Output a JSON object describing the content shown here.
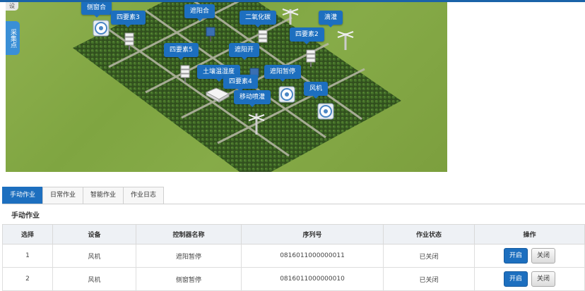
{
  "farm_view": {
    "side_tab_top": "设",
    "side_tab_label": "采集点",
    "device_tags": [
      {
        "label": "侧窗合"
      },
      {
        "label": "四要素3"
      },
      {
        "label": "遮阳合"
      },
      {
        "label": "二氧化碳"
      },
      {
        "label": "滴灌"
      },
      {
        "label": "四要素2"
      },
      {
        "label": "四要素5"
      },
      {
        "label": "遮阳开"
      },
      {
        "label": "土壤温湿度"
      },
      {
        "label": "遮阳暂停"
      },
      {
        "label": "四要素4"
      },
      {
        "label": "风机"
      },
      {
        "label": "移动喷灌"
      }
    ]
  },
  "tabs": [
    {
      "label": "手动作业",
      "active": true
    },
    {
      "label": "日常作业",
      "active": false
    },
    {
      "label": "智能作业",
      "active": false
    },
    {
      "label": "作业日志",
      "active": false
    }
  ],
  "section_title": "手动作业",
  "table": {
    "headers": [
      "选择",
      "设备",
      "控制器名称",
      "序列号",
      "作业状态",
      "操作"
    ],
    "rows": [
      {
        "select": "1",
        "device": "风机",
        "controller": "遮阳暂停",
        "serial": "0816011000000011",
        "status": "已关闭",
        "on_label": "开启",
        "off_label": "关闭"
      },
      {
        "select": "2",
        "device": "风机",
        "controller": "侧窗暂停",
        "serial": "0816011000000010",
        "status": "已关闭",
        "on_label": "开启",
        "off_label": "关闭"
      }
    ]
  }
}
